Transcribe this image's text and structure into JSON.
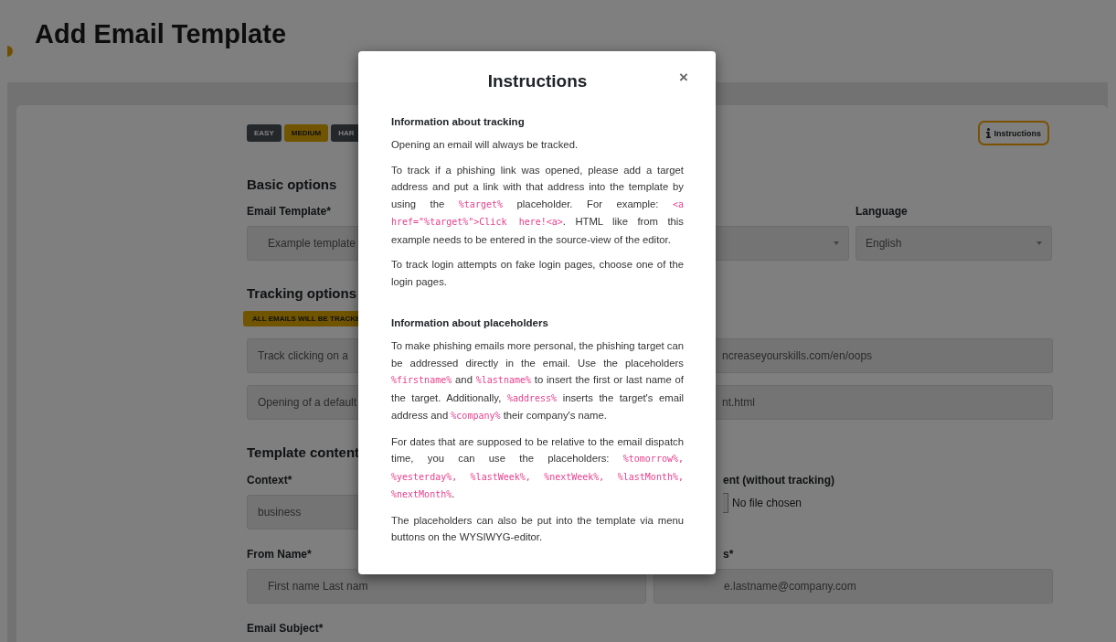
{
  "page_title": "Add Email Template",
  "difficulty": [
    {
      "label": "EASY",
      "selected": false
    },
    {
      "label": "MEDIUM",
      "selected": true
    },
    {
      "label": "HAR",
      "selected": false
    }
  ],
  "instructions_button": {
    "label": "Instructions",
    "focused": true
  },
  "basic_options": {
    "heading": "Basic options",
    "email_template": {
      "label": "Email Template*",
      "value": "Example template"
    },
    "language": {
      "label": "Language",
      "value": "English"
    }
  },
  "tracking_options": {
    "heading": "Tracking options",
    "badge": "ALL EMAILS WILL BE TRACKE",
    "fields": [
      {
        "left_text": "Track clicking on a",
        "right_text": "ncreaseyourskills.com/en/oops"
      },
      {
        "left_text": "Opening of a default",
        "right_text": "nt.html"
      }
    ]
  },
  "template_content": {
    "heading": "Template content",
    "context": {
      "label": "Context*",
      "value": "business"
    },
    "attachment": {
      "label": "ent (without tracking)",
      "file_status": "No file chosen"
    },
    "from_name": {
      "label": "From Name*",
      "value": "First name Last nam"
    },
    "from_address": {
      "label": "s*",
      "value": "e.lastname@company.com"
    },
    "email_subject": {
      "label": "Email Subject*"
    }
  },
  "modal": {
    "title": "Instructions",
    "close": "×",
    "sections": [
      {
        "heading": "Information about tracking",
        "paragraphs": [
          [
            {
              "kind": "text",
              "text": "Opening an email will always be tracked."
            }
          ],
          [
            {
              "kind": "text",
              "text": "To track if a phishing link was opened, please add a target address and put a link with that address into the template by using the "
            },
            {
              "kind": "code",
              "text": "%target%"
            },
            {
              "kind": "text",
              "text": " placeholder. For example: "
            },
            {
              "kind": "code",
              "text": "<a href=\"%target%\">Click here!<a>"
            },
            {
              "kind": "text",
              "text": ". HTML like from this example needs to be entered in the source-view of the editor."
            }
          ],
          [
            {
              "kind": "text",
              "text": "To track login attempts on fake login pages, choose one of the login pages."
            }
          ]
        ]
      },
      {
        "heading": "Information about placeholders",
        "paragraphs": [
          [
            {
              "kind": "text",
              "text": "To make phishing emails more personal, the phishing target can be addressed directly in the email. Use the placeholders "
            },
            {
              "kind": "code",
              "text": "%firstname%"
            },
            {
              "kind": "text",
              "text": " and "
            },
            {
              "kind": "code",
              "text": "%lastname%"
            },
            {
              "kind": "text",
              "text": " to insert the first or last name of the target. Additionally, "
            },
            {
              "kind": "code",
              "text": "%address%"
            },
            {
              "kind": "text",
              "text": " inserts the target's email address and "
            },
            {
              "kind": "code",
              "text": "%company%"
            },
            {
              "kind": "text",
              "text": " their company's name."
            }
          ],
          [
            {
              "kind": "text",
              "text": "For dates that are supposed to be relative to the email dispatch time, you can use the placeholders: "
            },
            {
              "kind": "code",
              "text": "%tomorrow%, %yesterday%, %lastWeek%, %nextWeek%, %lastMonth%, %nextMonth%"
            },
            {
              "kind": "text",
              "text": "."
            }
          ],
          [
            {
              "kind": "text",
              "text": "The placeholders can also be put into the template via menu buttons on the WYSIWYG-editor."
            }
          ]
        ]
      }
    ]
  }
}
